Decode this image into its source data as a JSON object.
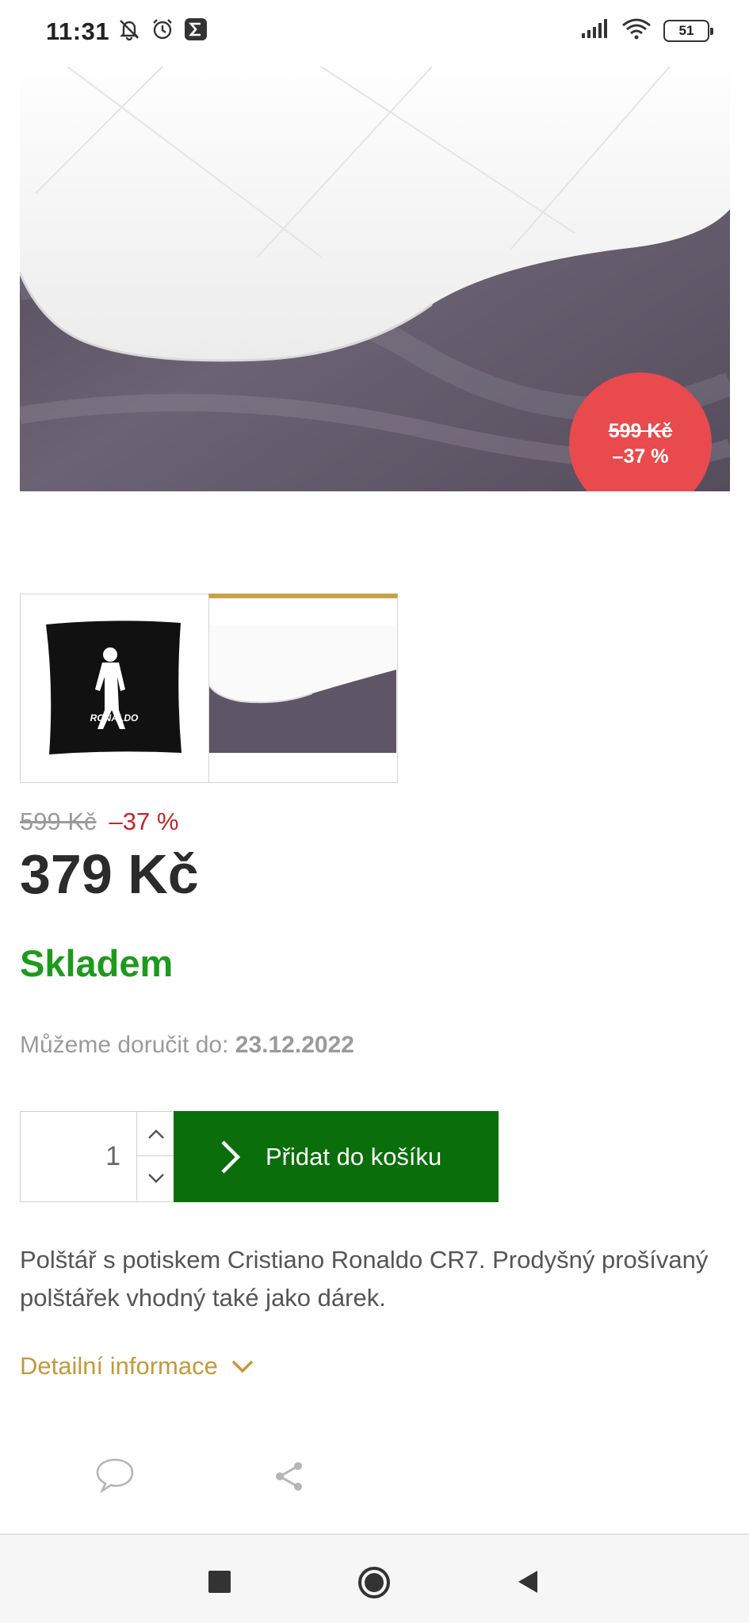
{
  "status_bar": {
    "time": "11:31",
    "battery": "51",
    "icons_left": [
      "bell-muted-icon",
      "alarm-icon",
      "sigma-app-icon"
    ],
    "icons_right": [
      "signal-icon",
      "wifi-icon",
      "battery-icon"
    ]
  },
  "product": {
    "badge": {
      "old_price": "599 Kč",
      "discount": "–37 %",
      "color": "#e84a4d"
    },
    "old_price": "599 Kč",
    "discount": "–37 %",
    "price": "379 Kč",
    "stock": "Skladem",
    "delivery_label": "Můžeme doručit do:",
    "delivery_date": "23.12.2022",
    "quantity": "1",
    "add_to_cart": "Přidat do košíku",
    "description": "Polštář s potiskem Cristiano Ronaldo CR7. Prodyšný prošívaný polštářek vhodný také jako dárek.",
    "detail_link": "Detailní informace",
    "thumbnails": [
      {
        "name": "black-pillow-ronaldo",
        "print_text": "RONALDO",
        "active": false
      },
      {
        "name": "white-pillow-closeup",
        "active": true
      }
    ]
  },
  "actions": [
    "comment-icon",
    "share-icon"
  ],
  "colors": {
    "accent_gold": "#c8a24a",
    "cart_green": "#0a6e0a",
    "stock_green": "#1d9a1d",
    "discount_red": "#c0262b"
  },
  "nav": [
    "recents-button",
    "home-button",
    "back-button"
  ]
}
